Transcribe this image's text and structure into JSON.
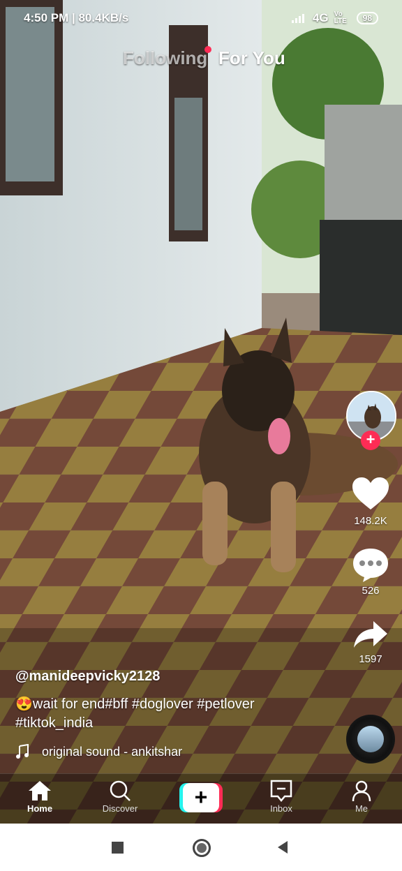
{
  "status_bar": {
    "time": "4:50 PM",
    "speed": "80.4KB/s",
    "network": "4G",
    "volte": "Vo LTE",
    "battery": "98"
  },
  "top_tabs": {
    "following": "Following",
    "for_you": "For You"
  },
  "actions": {
    "likes": "148.2K",
    "comments": "526",
    "shares": "1597"
  },
  "post": {
    "username": "@manideepvicky2128",
    "caption_line1": "wait for end#bff #doglover #petlover",
    "caption_line2": "#tiktok_india",
    "emoji": "😍",
    "sound": "original sound - ankitshar"
  },
  "tabbar": {
    "home": "Home",
    "discover": "Discover",
    "inbox": "Inbox",
    "me": "Me"
  },
  "colors": {
    "accent": "#fe2c55",
    "cyan": "#25f4ee"
  }
}
